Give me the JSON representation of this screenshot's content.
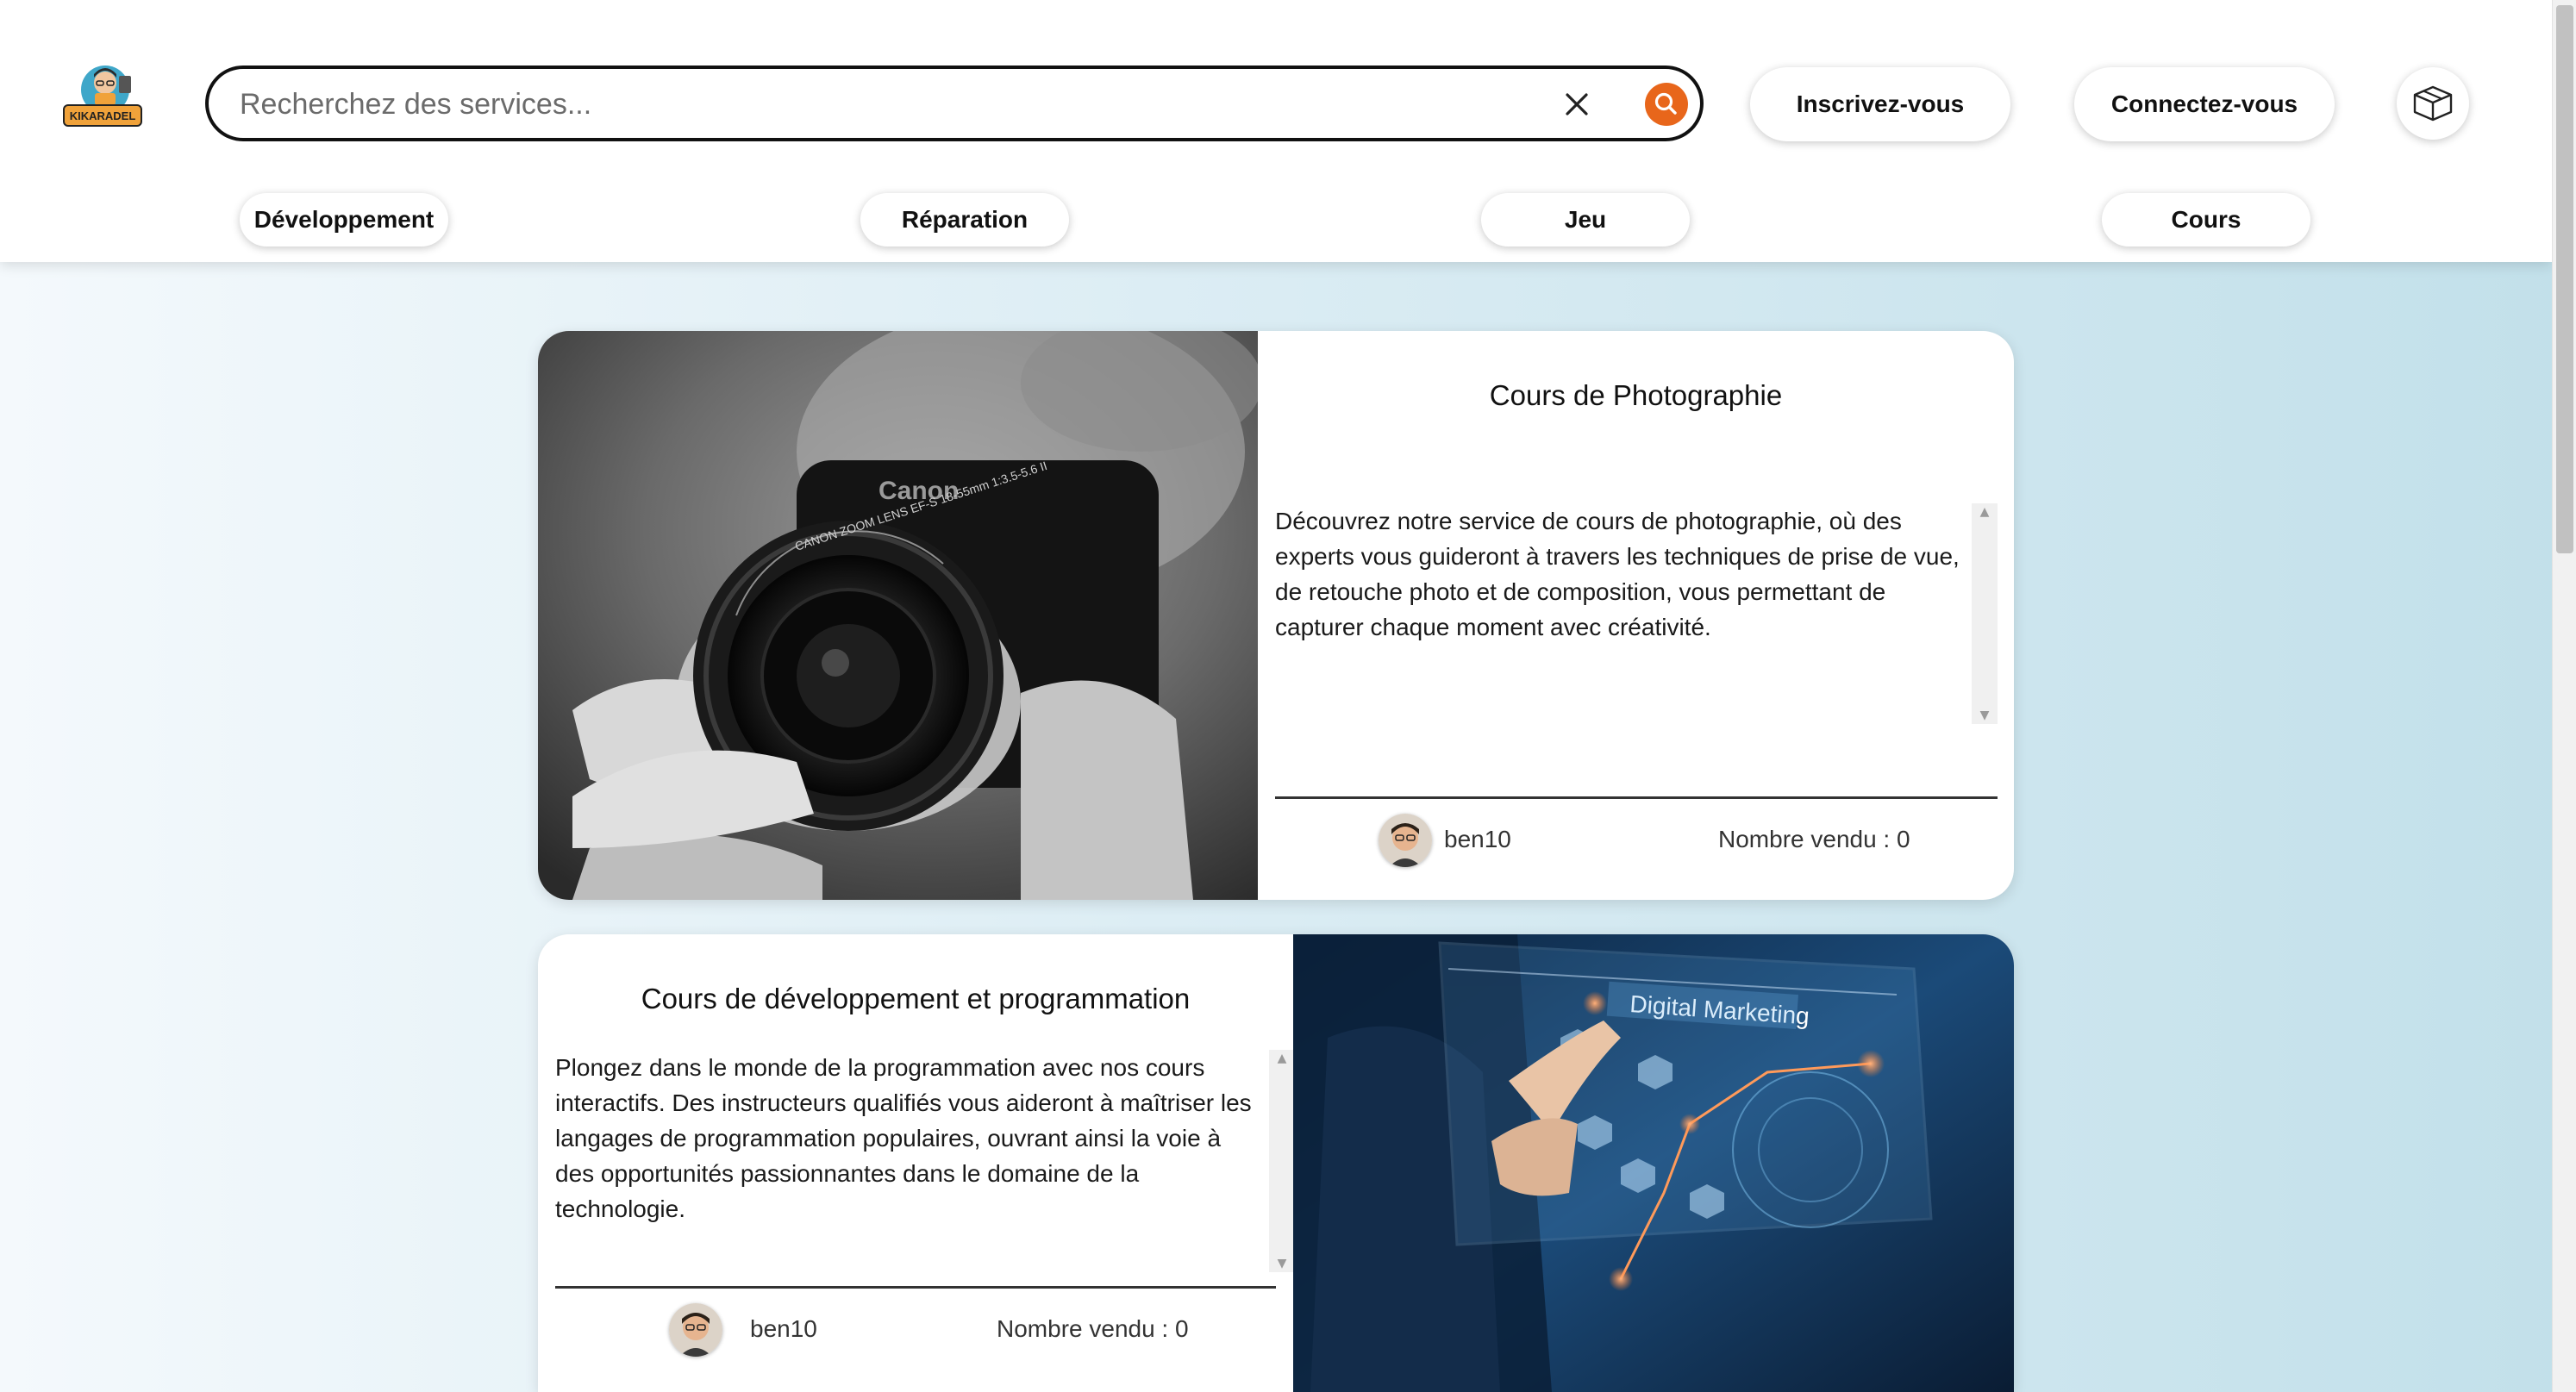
{
  "header": {
    "logo_text": "KIKARADEL",
    "search": {
      "placeholder": "Recherchez des services...",
      "value": ""
    },
    "signup_label": "Inscrivez-vous",
    "login_label": "Connectez-vous",
    "categories": [
      "Développement",
      "Réparation",
      "Jeu",
      "Cours"
    ]
  },
  "services": [
    {
      "title": "Cours de Photographie",
      "description": "Découvrez notre service de cours de photographie, où des experts vous guideront à travers les techniques de prise de vue, de retouche photo et de composition, vous permettant de capturer chaque moment avec créativité.",
      "seller": "ben10",
      "sold_label": "Nombre vendu : 0",
      "image": "camera-photo",
      "image_lens_text": "CANON ZOOM LENS EF-S 18-55mm 1:3.5-5.6 II",
      "image_brand_text": "Canon"
    },
    {
      "title": "Cours de développement et programmation",
      "description": "Plongez dans le monde de la programmation avec nos cours interactifs. Des instructeurs qualifiés vous aideront à maîtriser les langages de programmation populaires, ouvrant ainsi la voie à des opportunités passionnantes dans le domaine de la technologie.",
      "seller": "ben10",
      "sold_label": "Nombre vendu : 0",
      "image": "digital-marketing-photo",
      "image_caption": "Digital Marketing"
    }
  ],
  "colors": {
    "accent": "#e8661b",
    "card_bg": "#ffffff",
    "page_gradient_start": "#f4f9fc",
    "page_gradient_end": "#c2e0ea"
  }
}
